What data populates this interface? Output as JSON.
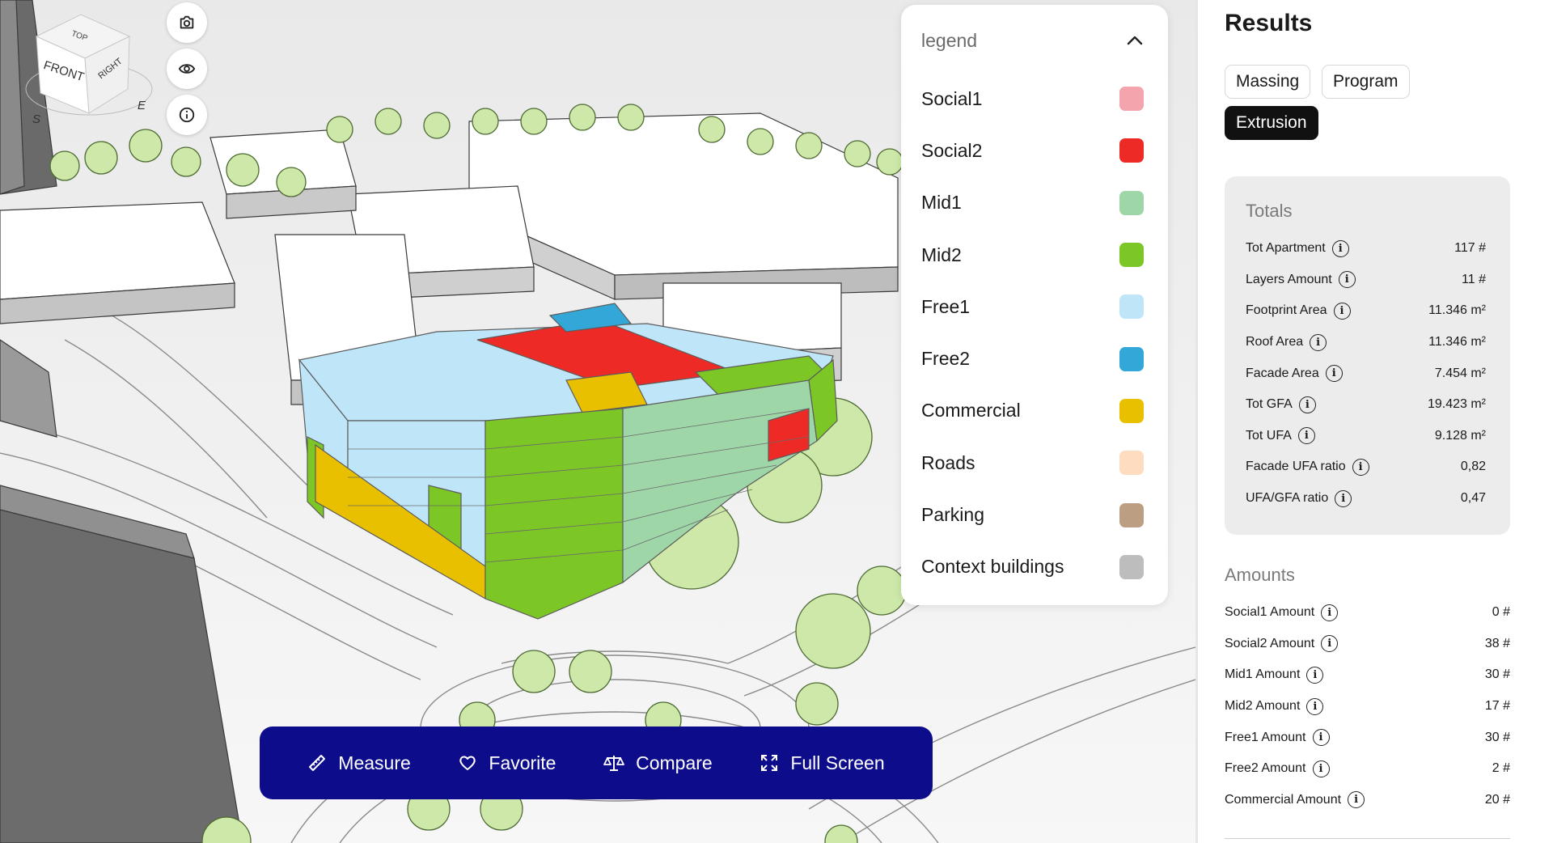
{
  "legend": {
    "title": "legend",
    "items": [
      {
        "label": "Social1",
        "color": "#f4a4ad"
      },
      {
        "label": "Social2",
        "color": "#ee2a26"
      },
      {
        "label": "Mid1",
        "color": "#9ed6a8"
      },
      {
        "label": "Mid2",
        "color": "#7cc626"
      },
      {
        "label": "Free1",
        "color": "#bfe6f8"
      },
      {
        "label": "Free2",
        "color": "#33a8d8"
      },
      {
        "label": "Commercial",
        "color": "#e8c000"
      },
      {
        "label": "Roads",
        "color": "#fddcc0"
      },
      {
        "label": "Parking",
        "color": "#bc9e82"
      },
      {
        "label": "Context buildings",
        "color": "#bdbdbd"
      }
    ]
  },
  "viewcube": {
    "top": "TOP",
    "front": "FRONT",
    "right": "RIGHT",
    "e": "E",
    "s": "S"
  },
  "toolbar": {
    "measure": "Measure",
    "favorite": "Favorite",
    "compare": "Compare",
    "fullscreen": "Full Screen"
  },
  "panel": {
    "title": "Results",
    "tabs": [
      {
        "label": "Massing"
      },
      {
        "label": "Program"
      },
      {
        "label": "Extrusion",
        "active": true
      }
    ],
    "totals": {
      "title": "Totals",
      "rows": [
        {
          "label": "Tot Apartment",
          "value": "117 #"
        },
        {
          "label": "Layers Amount",
          "value": "11 #"
        },
        {
          "label": "Footprint Area",
          "value": "11.346 m²"
        },
        {
          "label": "Roof Area",
          "value": "11.346 m²"
        },
        {
          "label": "Facade Area",
          "value": "7.454 m²"
        },
        {
          "label": "Tot GFA",
          "value": "19.423 m²"
        },
        {
          "label": "Tot UFA",
          "value": "9.128 m²"
        },
        {
          "label": "Facade UFA ratio",
          "value": "0,82"
        },
        {
          "label": "UFA/GFA ratio",
          "value": "0,47"
        }
      ]
    },
    "amounts": {
      "title": "Amounts",
      "rows": [
        {
          "label": "Social1 Amount",
          "value": "0 #"
        },
        {
          "label": "Social2 Amount",
          "value": "38 #"
        },
        {
          "label": "Mid1 Amount",
          "value": "30 #"
        },
        {
          "label": "Mid2 Amount",
          "value": "17 #"
        },
        {
          "label": "Free1 Amount",
          "value": "30 #"
        },
        {
          "label": "Free2 Amount",
          "value": "2 #"
        },
        {
          "label": "Commercial Amount",
          "value": "20 #"
        }
      ]
    }
  }
}
